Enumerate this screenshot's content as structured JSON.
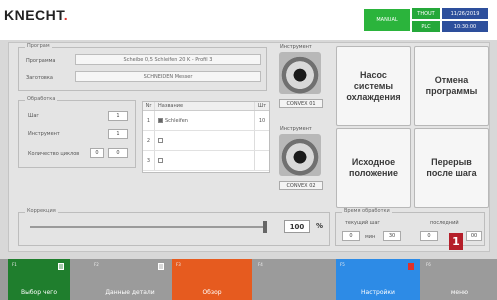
{
  "header": {
    "logo": "KNECHT",
    "status_green": "MANUAL",
    "chips": [
      "THOUT",
      "11/26/2019",
      "PLC",
      "10:30:00"
    ]
  },
  "program": {
    "title": "Програм",
    "row1_label": "Программа",
    "row1_value": "Scheibe 0,5 Schleifen 20 K - Profil 3",
    "row2_label": "Заготовка",
    "row2_value": "SCHNEIDEN Messer"
  },
  "workflow": {
    "title": "Обработка",
    "rows": [
      {
        "label": "Шаг",
        "v1": "1",
        "v2": ""
      },
      {
        "label": "Инструмент",
        "v1": "1",
        "v2": ""
      },
      {
        "label": "Количество циклов",
        "v1": "0",
        "v2": "0"
      }
    ]
  },
  "table": {
    "headers": [
      "Nr",
      "Название",
      "Шт"
    ],
    "rows": [
      {
        "nr": "1",
        "name": "Schleifen",
        "qty": "10",
        "checked": true
      },
      {
        "nr": "2",
        "name": "",
        "qty": "",
        "checked": false
      },
      {
        "nr": "3",
        "name": "",
        "qty": "",
        "checked": false
      }
    ]
  },
  "tools": {
    "title1": "Инструмент",
    "code1": "CONVEX 01",
    "title2": "Инструмент",
    "code2": "CONVEX 02"
  },
  "buttons": {
    "coolant_pump": "Насос системы охлаждения",
    "cancel_program": "Отмена программы",
    "home_position": "Исходное положение",
    "pause_after_step": "Перерыв после шага"
  },
  "correction": {
    "title": "Коррекция",
    "percent_value": "100",
    "percent_unit": "%",
    "level": 0.99
  },
  "duration": {
    "title": "Время обработки",
    "current_label": "текущий шаг",
    "remaining_label": "последний",
    "current_a": "0",
    "current_sep": "мин",
    "current_b": "30",
    "remaining_a": "0",
    "remaining_b": "00"
  },
  "marker": "1",
  "footer": [
    {
      "num": "F1",
      "label": "Выбор чего",
      "color": "#1f7e2d"
    },
    {
      "num": "F2",
      "label": "Данные детали",
      "color": "#9b9b9b"
    },
    {
      "num": "F3",
      "label": "Обзор",
      "color": "#e65b1f"
    },
    {
      "num": "F4",
      "label": "",
      "color": "#9b9b9b"
    },
    {
      "num": "F5",
      "label": "Настройки",
      "color": "#2d8be6"
    },
    {
      "num": "F6",
      "label": "меню",
      "color": "#9b9b9b"
    }
  ]
}
